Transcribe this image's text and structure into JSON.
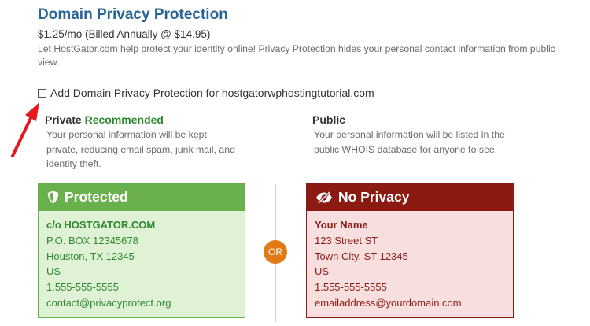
{
  "section": {
    "title": "Domain Privacy Protection",
    "price": "$1.25/mo (Billed Annually @ $14.95)",
    "description": "Let HostGator.com help protect your identity online! Privacy Protection hides your personal contact information from public view."
  },
  "checkbox": {
    "label": "Add Domain Privacy Protection for hostgatorwphostingtutorial.com",
    "checked": false
  },
  "private_option": {
    "title": "Private",
    "recommended": "Recommended",
    "description": "Your personal information will be kept private, reducing email spam, junk mail, and identity theft."
  },
  "public_option": {
    "title": "Public",
    "description": "Your personal information will be listed in the public WHOIS database for anyone to see."
  },
  "or_label": "OR",
  "protected_card": {
    "header": "Protected",
    "icon": "shield-icon",
    "lines": [
      "c/o HOSTGATOR.COM",
      "P.O. BOX 12345678",
      "Houston, TX 12345",
      "US",
      "1.555-555-5555",
      "contact@privacyprotect.org"
    ]
  },
  "noprivacy_card": {
    "header": "No Privacy",
    "icon": "eye-slash-icon",
    "lines": [
      "Your Name",
      "123 Street ST",
      "Town City, ST 12345",
      "US",
      "1.555-555-5555",
      "emailaddress@yourdomain.com"
    ]
  },
  "colors": {
    "title_blue": "#2a6496",
    "green": "#6ab04c",
    "green_bg": "#dff2d6",
    "green_text": "#2f8a2f",
    "red": "#8b1a12",
    "red_bg": "#f7dfe0",
    "or_orange": "#e07b17",
    "annotation_arrow": "#e3191f"
  }
}
